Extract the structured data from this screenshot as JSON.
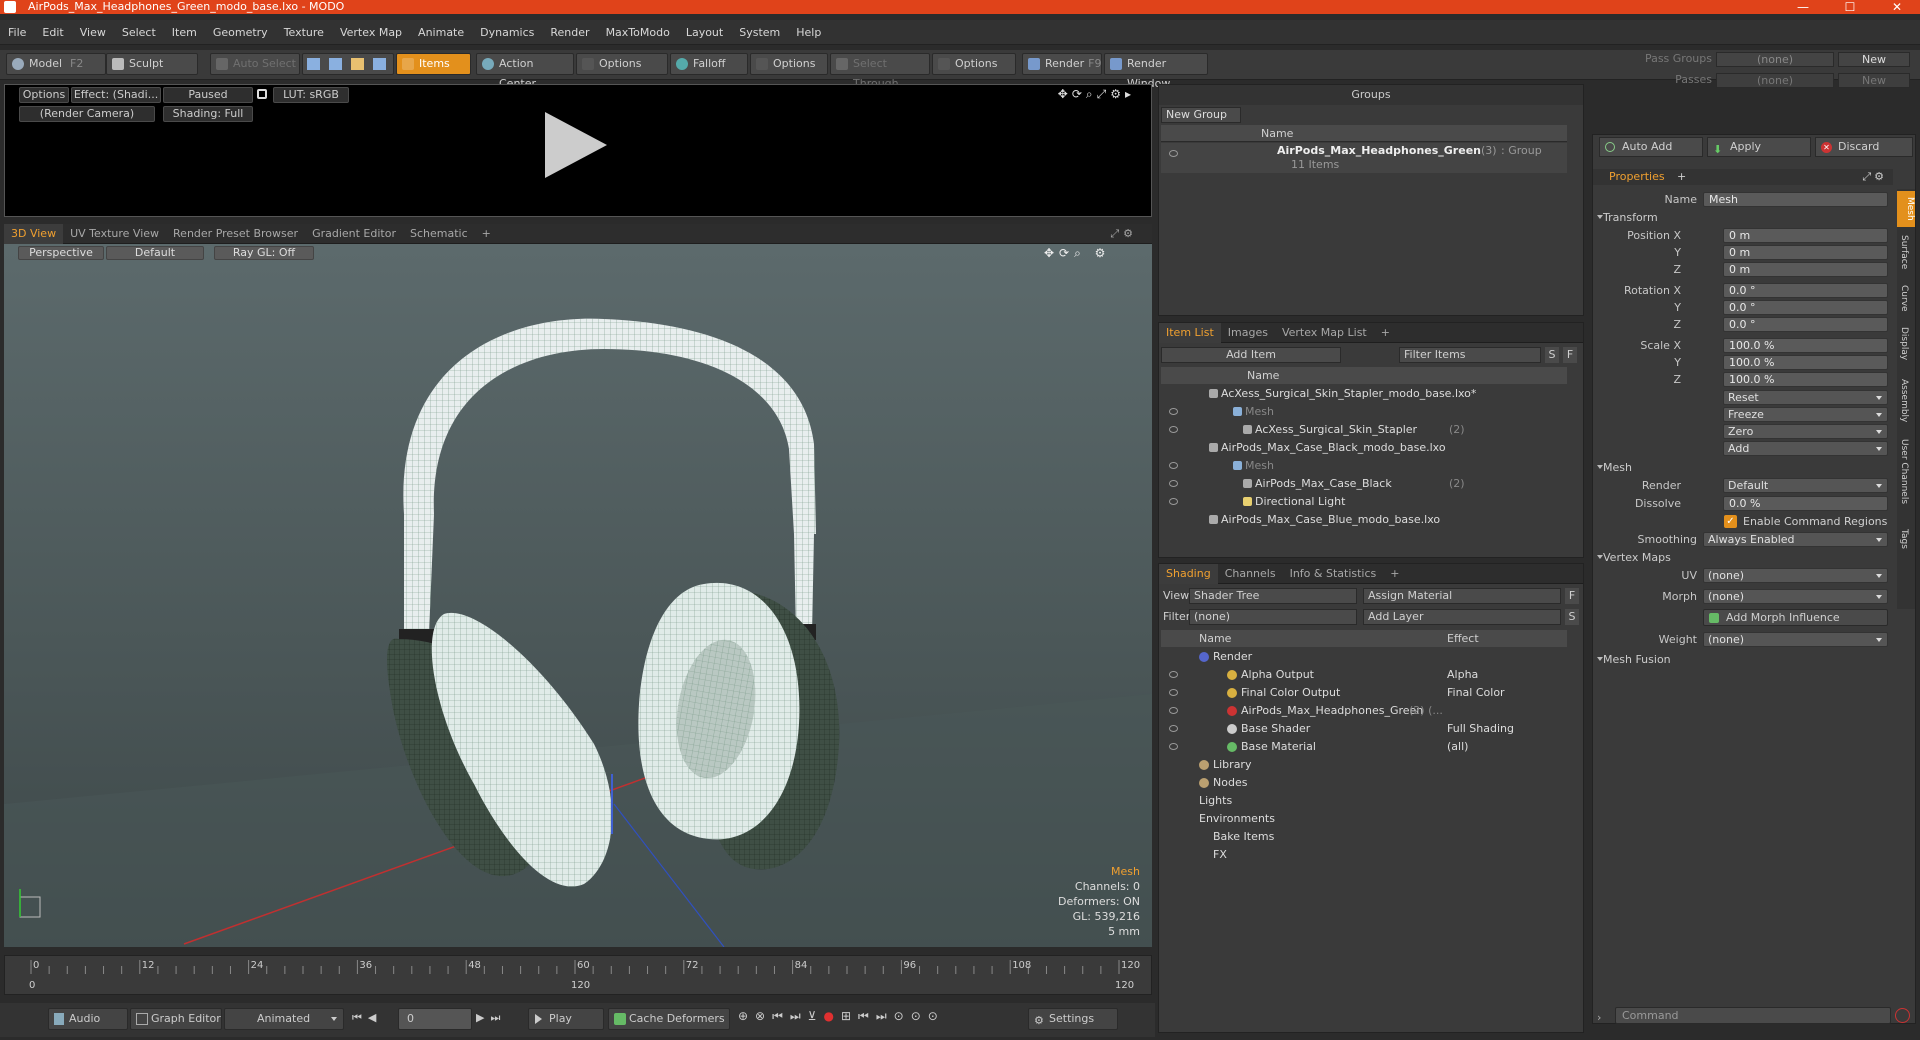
{
  "window": {
    "title": "AirPods_Max_Headphones_Green_modo_base.lxo - MODO"
  },
  "menu": [
    "File",
    "Edit",
    "View",
    "Select",
    "Item",
    "Geometry",
    "Texture",
    "Vertex Map",
    "Animate",
    "Dynamics",
    "Render",
    "MaxToModo",
    "Layout",
    "System",
    "Help"
  ],
  "toolbar": {
    "model": "Model",
    "model_key": "F2",
    "sculpt": "Sculpt",
    "auto_select": "Auto Select",
    "items": "Items",
    "action_center": "Action Center",
    "options1": "Options",
    "falloff": "Falloff",
    "options2": "Options",
    "select_through": "Select Through",
    "options3": "Options",
    "render": "Render",
    "render_key": "F9",
    "render_window": "Render Window",
    "pass_groups_label": "Pass Groups",
    "pass_groups_value": "(none)",
    "new": "New",
    "passes_label": "Passes",
    "passes_value": "(none)",
    "passes_new": "New"
  },
  "preview": {
    "options": "Options",
    "effect": "Effect: (Shadi...",
    "paused": "Paused",
    "lut": "LUT: sRGB",
    "camera": "(Render Camera)",
    "shading": "Shading: Full"
  },
  "view_tabs": [
    "3D View",
    "UV Texture View",
    "Render Preset Browser",
    "Gradient Editor",
    "Schematic"
  ],
  "viewport": {
    "perspective": "Perspective",
    "default": "Default",
    "raygl": "Ray GL: Off",
    "stats": {
      "mode": "Mesh",
      "channels": "Channels: 0",
      "deformers": "Deformers: ON",
      "gl": "GL: 539,216",
      "unit": "5 mm"
    }
  },
  "timeline": {
    "ticks": [
      "0",
      "12",
      "24",
      "36",
      "48",
      "60",
      "72",
      "84",
      "96",
      "108",
      "120"
    ],
    "start": "0",
    "mid": "120",
    "end": "120"
  },
  "bottom": {
    "audio": "Audio",
    "graph_editor": "Graph Editor",
    "animated": "Animated",
    "frame": "0",
    "play": "Play",
    "cache": "Cache Deformers",
    "settings": "Settings"
  },
  "groups": {
    "title": "Groups",
    "new_group": "New Group",
    "col_name": "Name",
    "item_name": "AirPods_Max_Headphones_Green",
    "item_count": "(3)",
    "item_type": ": Group",
    "item_sub": "11 Items"
  },
  "itemlist": {
    "tabs": [
      "Item List",
      "Images",
      "Vertex Map List"
    ],
    "add_item": "Add Item",
    "filter": "Filter Items",
    "s": "S",
    "f": "F",
    "col_name": "Name",
    "rows": [
      {
        "label": "AcXess_Surgical_Skin_Stapler_modo_base.lxo*",
        "dim": ""
      },
      {
        "label": "Mesh",
        "dim": ""
      },
      {
        "label": "AcXess_Surgical_Skin_Stapler",
        "dim": "(2)"
      },
      {
        "label": "AirPods_Max_Case_Black_modo_base.lxo",
        "dim": ""
      },
      {
        "label": "Mesh",
        "dim": ""
      },
      {
        "label": "AirPods_Max_Case_Black",
        "dim": "(2)"
      },
      {
        "label": "Directional Light",
        "dim": ""
      },
      {
        "label": "AirPods_Max_Case_Blue_modo_base.lxo",
        "dim": ""
      }
    ]
  },
  "shading": {
    "tabs": [
      "Shading",
      "Channels",
      "Info & Statistics"
    ],
    "view_label": "View",
    "view_value": "Shader Tree",
    "assign": "Assign Material",
    "f": "F",
    "filter_label": "Filter",
    "filter_value": "(none)",
    "add_layer": "Add Layer",
    "s": "S",
    "col_name": "Name",
    "col_effect": "Effect",
    "rows": [
      {
        "name": "Render",
        "effect": ""
      },
      {
        "name": "Alpha Output",
        "effect": "Alpha"
      },
      {
        "name": "Final Color Output",
        "effect": "Final Color"
      },
      {
        "name": "AirPods_Max_Headphones_Green",
        "dim": "(2) (...",
        "effect": ""
      },
      {
        "name": "Base Shader",
        "effect": "Full Shading"
      },
      {
        "name": "Base Material",
        "effect": "(all)"
      },
      {
        "name": "Library",
        "effect": ""
      },
      {
        "name": "Nodes",
        "effect": ""
      },
      {
        "name": "Lights",
        "effect": ""
      },
      {
        "name": "Environments",
        "effect": ""
      },
      {
        "name": "Bake Items",
        "effect": ""
      },
      {
        "name": "FX",
        "effect": ""
      }
    ]
  },
  "properties": {
    "auto_add": "Auto Add",
    "apply": "Apply",
    "discard": "Discard",
    "tab": "Properties",
    "name_label": "Name",
    "name_value": "Mesh",
    "transform": "Transform",
    "pos_label": "Position X",
    "rot_label": "Rotation X",
    "scale_label": "Scale X",
    "y": "Y",
    "z": "Z",
    "pos": [
      "0 m",
      "0 m",
      "0 m"
    ],
    "rot": [
      "0.0 °",
      "0.0 °",
      "0.0 °"
    ],
    "scale": [
      "100.0 %",
      "100.0 %",
      "100.0 %"
    ],
    "reset": "Reset",
    "freeze": "Freeze",
    "zero": "Zero",
    "add": "Add",
    "mesh": "Mesh",
    "render_label": "Render",
    "render_value": "Default",
    "dissolve_label": "Dissolve",
    "dissolve_value": "0.0 %",
    "enable_cmd": "Enable Command Regions",
    "smoothing_label": "Smoothing",
    "smoothing_value": "Always Enabled",
    "vertex_maps": "Vertex Maps",
    "uv_label": "UV",
    "uv_value": "(none)",
    "morph_label": "Morph",
    "morph_value": "(none)",
    "add_morph": "Add Morph Influence",
    "weight_label": "Weight",
    "weight_value": "(none)",
    "mesh_fusion": "Mesh Fusion",
    "side_tabs": [
      "Mesh",
      "Surface",
      "Curve",
      "Display",
      "Assembly",
      "User Channels",
      "Tags"
    ],
    "command": "Command"
  },
  "colors": {
    "accent": "#e3901c",
    "title_bar": "#e0431a",
    "mesh_green": "#3f4f45"
  }
}
